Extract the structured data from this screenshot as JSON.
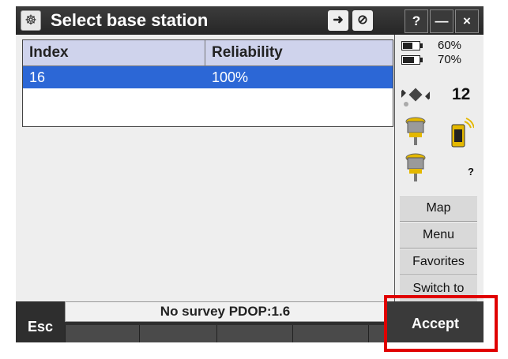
{
  "window": {
    "title": "Select base station",
    "icons": [
      "app-icon",
      "login-arrow-icon",
      "no-entry-icon"
    ],
    "buttons": {
      "help": "?",
      "minimize": "—",
      "close": "×"
    }
  },
  "table": {
    "headers": {
      "index": "Index",
      "reliability": "Reliability"
    },
    "rows": [
      {
        "index": "16",
        "reliability": "100%"
      }
    ],
    "selected_row_color": "#2c67d6"
  },
  "status": {
    "battery1": "60%",
    "battery2": "70%",
    "battery1_level": 0.6,
    "battery2_level": 0.7,
    "satellites": "12",
    "unknown": "?"
  },
  "side_menu": {
    "map": "Map",
    "menu": "Menu",
    "favorites": "Favorites",
    "switch_to": "Switch to"
  },
  "bottom": {
    "esc": "Esc",
    "status_text": "No survey  PDOP:1.6",
    "accept": "Accept",
    "highlight_color": "#e00000"
  }
}
